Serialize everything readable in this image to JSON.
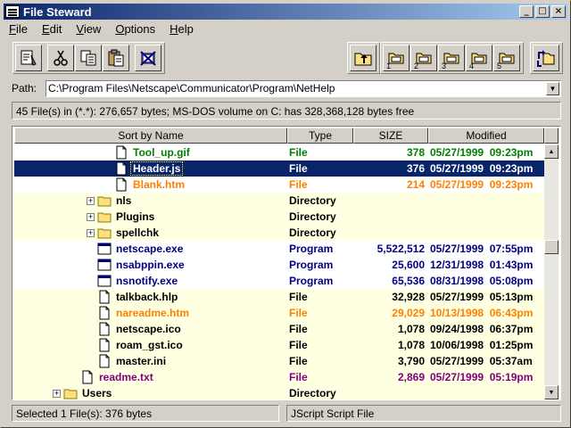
{
  "window": {
    "title": "File Steward"
  },
  "menu": [
    "File",
    "Edit",
    "View",
    "Options",
    "Help"
  ],
  "menu_underline": [
    "F",
    "E",
    "V",
    "O",
    "H"
  ],
  "toolbar": {
    "buttons_left": [
      "properties-icon",
      "cut-icon",
      "copy-icon",
      "paste-icon",
      "delete-icon"
    ],
    "buttons_right": [
      "up-folder-icon"
    ],
    "favorites": [
      "1",
      "2",
      "3",
      "4",
      "5"
    ],
    "last": "swap-icon"
  },
  "path": {
    "label": "Path:",
    "value": "C:\\Program Files\\Netscape\\Communicator\\Program\\NetHelp"
  },
  "info": "45 File(s) in (*.*): 276,657 bytes; MS-DOS volume on C: has 328,368,128 bytes free",
  "columns": [
    "Sort by Name",
    "Type",
    "SIZE",
    "Modified"
  ],
  "rows": [
    {
      "name": "Tool_up.gif",
      "type": "File",
      "size": "378",
      "modified": "05/27/1999  09:23pm",
      "icon": "file-icon",
      "color": "#008000",
      "indent": 6,
      "alt": false
    },
    {
      "name": "Header.js",
      "type": "File",
      "size": "376",
      "modified": "05/27/1999  09:23pm",
      "icon": "file-icon",
      "color": "#ffffff",
      "indent": 6,
      "selected": true
    },
    {
      "name": "Blank.htm",
      "type": "File",
      "size": "214",
      "modified": "05/27/1999  09:23pm",
      "icon": "file-icon",
      "color": "#ff8000",
      "indent": 6,
      "alt": false
    },
    {
      "name": "nls",
      "type": "Directory",
      "size": "",
      "modified": "",
      "icon": "folder-icon",
      "color": "#000000",
      "indent": 5,
      "expander": "+",
      "alt": true
    },
    {
      "name": "Plugins",
      "type": "Directory",
      "size": "",
      "modified": "",
      "icon": "folder-icon",
      "color": "#000000",
      "indent": 5,
      "expander": "+",
      "alt": true
    },
    {
      "name": "spellchk",
      "type": "Directory",
      "size": "",
      "modified": "",
      "icon": "folder-icon",
      "color": "#000000",
      "indent": 5,
      "expander": "+",
      "alt": true
    },
    {
      "name": "netscape.exe",
      "type": "Program",
      "size": "5,522,512",
      "modified": "05/27/1999  07:55pm",
      "icon": "program-icon",
      "color": "#000080",
      "indent": 5,
      "alt": false
    },
    {
      "name": "nsabppin.exe",
      "type": "Program",
      "size": "25,600",
      "modified": "12/31/1998  01:43pm",
      "icon": "program-icon",
      "color": "#000080",
      "indent": 5,
      "alt": false
    },
    {
      "name": "nsnotify.exe",
      "type": "Program",
      "size": "65,536",
      "modified": "08/31/1998  05:08pm",
      "icon": "program-icon",
      "color": "#000080",
      "indent": 5,
      "alt": false
    },
    {
      "name": "talkback.hlp",
      "type": "File",
      "size": "32,928",
      "modified": "05/27/1999  05:13pm",
      "icon": "file-icon",
      "color": "#000000",
      "indent": 5,
      "alt": true
    },
    {
      "name": "nareadme.htm",
      "type": "File",
      "size": "29,029",
      "modified": "10/13/1998  06:43pm",
      "icon": "file-icon",
      "color": "#ff8000",
      "indent": 5,
      "alt": true
    },
    {
      "name": "netscape.ico",
      "type": "File",
      "size": "1,078",
      "modified": "09/24/1998  06:37pm",
      "icon": "file-icon",
      "color": "#000000",
      "indent": 5,
      "alt": true
    },
    {
      "name": "roam_gst.ico",
      "type": "File",
      "size": "1,078",
      "modified": "10/06/1998  01:25pm",
      "icon": "file-icon",
      "color": "#000000",
      "indent": 5,
      "alt": true
    },
    {
      "name": "master.ini",
      "type": "File",
      "size": "3,790",
      "modified": "05/27/1999  05:37am",
      "icon": "file-icon",
      "color": "#000000",
      "indent": 5,
      "alt": true
    },
    {
      "name": "readme.txt",
      "type": "File",
      "size": "2,869",
      "modified": "05/27/1999  05:19pm",
      "icon": "file-icon",
      "color": "#800080",
      "indent": 4,
      "alt": true
    },
    {
      "name": "Users",
      "type": "Directory",
      "size": "",
      "modified": "",
      "icon": "folder-icon",
      "color": "#000000",
      "indent": 3,
      "expander": "+",
      "alt": true
    }
  ],
  "status": {
    "left": "Selected 1 File(s): 376 bytes",
    "right": "JScript Script File"
  }
}
